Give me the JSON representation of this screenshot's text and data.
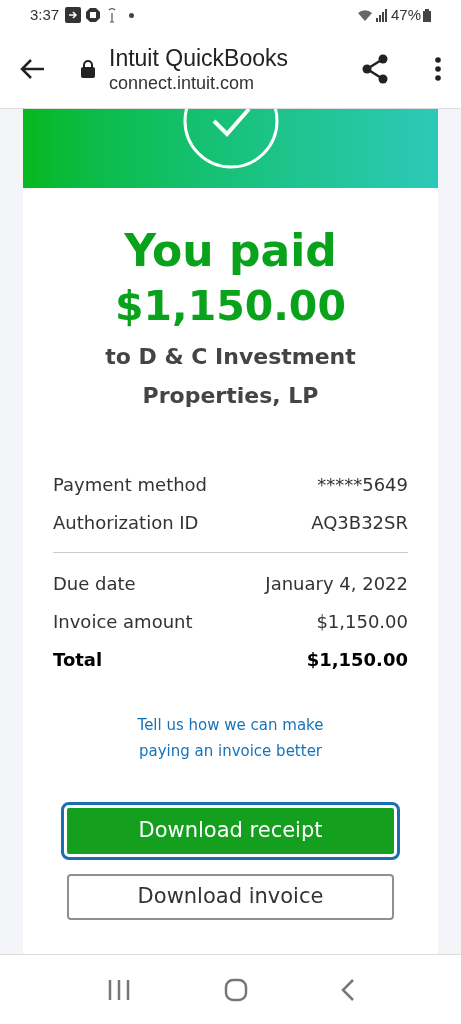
{
  "status_bar": {
    "time": "3:37",
    "battery": "47%"
  },
  "browser": {
    "title": "Intuit QuickBooks",
    "url": "connect.intuit.com"
  },
  "receipt": {
    "heading": "You paid",
    "amount": "$1,150.00",
    "payee": "to D & C Investment Properties, LP",
    "groups": [
      [
        {
          "label": "Payment method",
          "value": "*****5649",
          "bold": false
        },
        {
          "label": "Authorization ID",
          "value": "AQ3B32SR",
          "bold": false
        }
      ],
      [
        {
          "label": "Due date",
          "value": "January 4, 2022",
          "bold": false
        },
        {
          "label": "Invoice amount",
          "value": "$1,150.00",
          "bold": false
        },
        {
          "label": "Total",
          "value": "$1,150.00",
          "bold": true
        }
      ]
    ],
    "feedback_link": "Tell us how we can make paying an invoice better",
    "buttons": [
      {
        "label": "Download receipt",
        "kind": "primary",
        "focused": true
      },
      {
        "label": "Download invoice",
        "kind": "secondary",
        "focused": false
      }
    ]
  }
}
